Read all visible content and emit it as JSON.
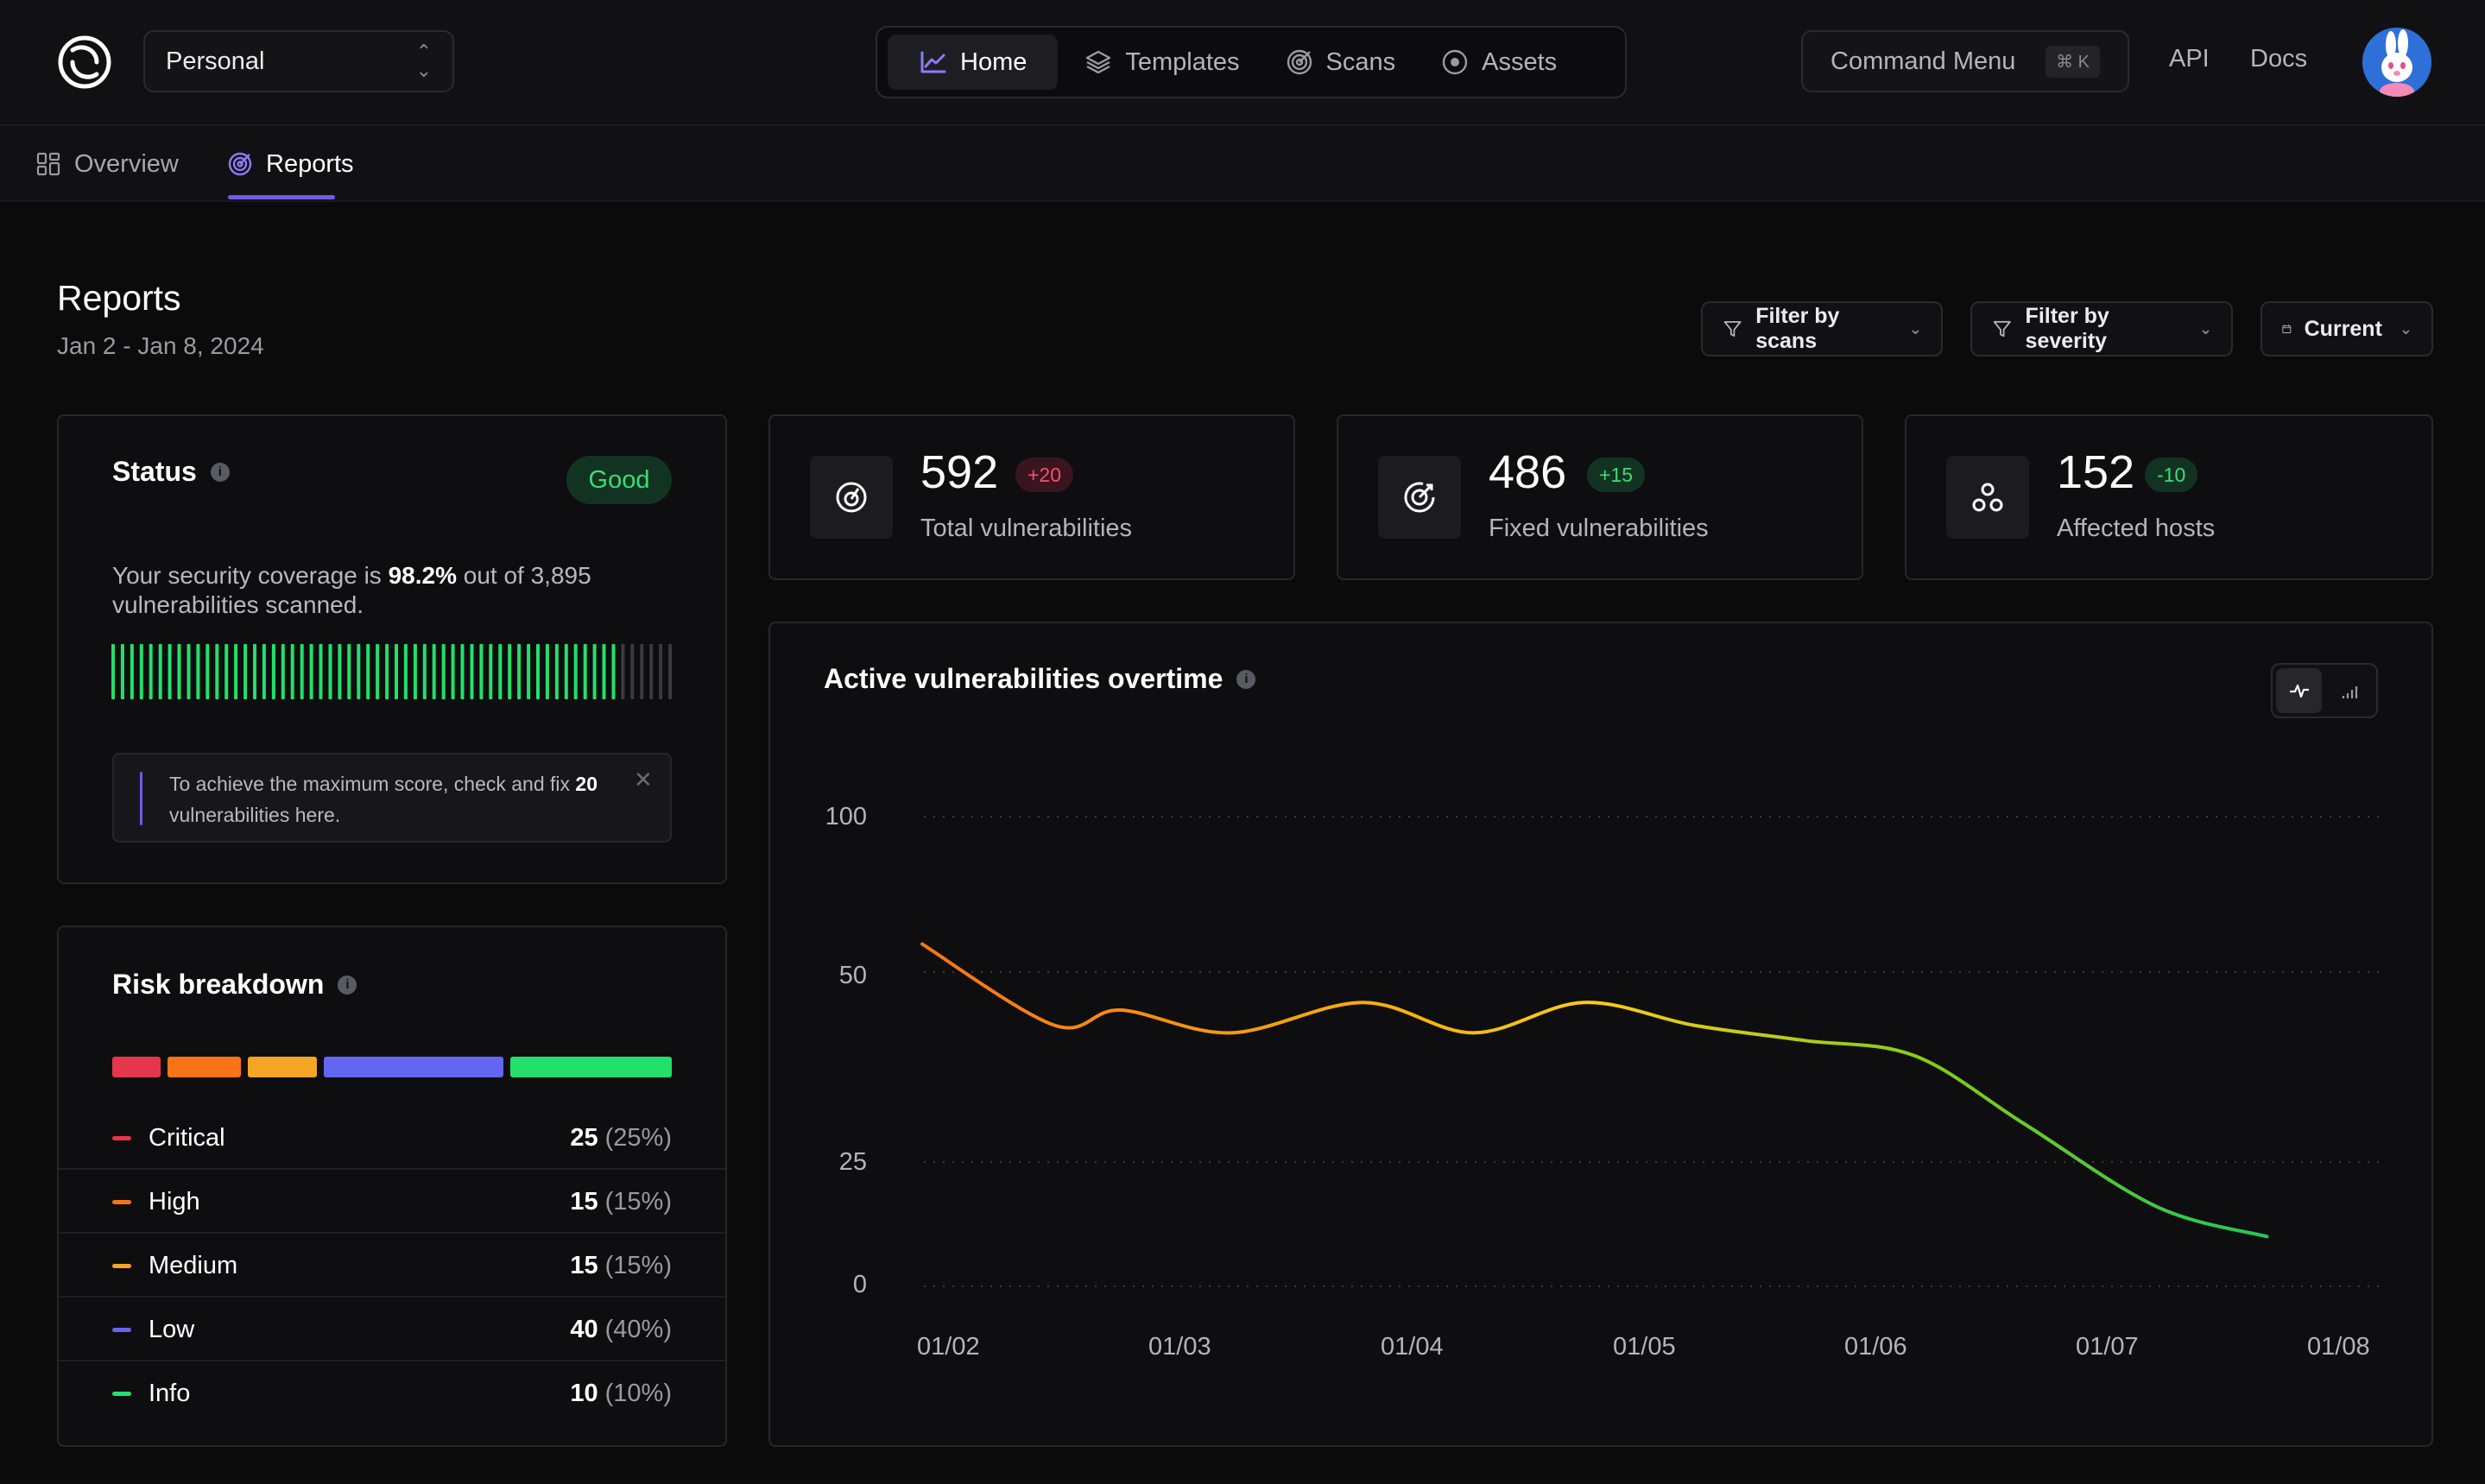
{
  "topbar": {
    "workspace": "Personal",
    "nav": [
      {
        "label": "Home",
        "icon": "chart-line-icon",
        "active": true
      },
      {
        "label": "Templates",
        "icon": "layers-icon",
        "active": false
      },
      {
        "label": "Scans",
        "icon": "target-icon",
        "active": false
      },
      {
        "label": "Assets",
        "icon": "radio-circle-icon",
        "active": false
      }
    ],
    "command_menu": "Command Menu",
    "command_shortcut": "⌘ K",
    "api": "API",
    "docs": "Docs"
  },
  "subnav": {
    "overview": "Overview",
    "reports": "Reports"
  },
  "header": {
    "title": "Reports",
    "date_range": "Jan 2 - Jan 8, 2024",
    "filter_scans": "Filter by scans",
    "filter_severity": "Filter by severity",
    "period": "Current"
  },
  "status": {
    "title": "Status",
    "badge": "Good",
    "coverage_prefix": "Your security coverage is ",
    "coverage_value": "98.2%",
    "coverage_mid": " out of 3,895",
    "coverage_suffix": "vulnerabilities scanned.",
    "coverage_fraction": 0.898,
    "hint_prefix": "To achieve the maximum score, check and fix ",
    "hint_count": "20",
    "hint_suffix": " vulnerabilities here."
  },
  "risk": {
    "title": "Risk breakdown",
    "rows": [
      {
        "label": "Critical",
        "count": "25",
        "pct": "(25%)",
        "color": "#e5364b"
      },
      {
        "label": "High",
        "count": "15",
        "pct": "(15%)",
        "color": "#f97316"
      },
      {
        "label": "Medium",
        "count": "15",
        "pct": "(15%)",
        "color": "#f5a524"
      },
      {
        "label": "Low",
        "count": "40",
        "pct": "(40%)",
        "color": "#6366f1"
      },
      {
        "label": "Info",
        "count": "10",
        "pct": "(10%)",
        "color": "#22e06b"
      }
    ]
  },
  "stats": [
    {
      "value": "592",
      "delta": "+20",
      "label": "Total vulnerabilities",
      "icon": "radar-icon",
      "delta_color": "#ff4d6a",
      "delta_bg": "#3a1520"
    },
    {
      "value": "486",
      "delta": "+15",
      "label": "Fixed vulnerabilities",
      "icon": "target-check-icon",
      "delta_color": "#3ddc74",
      "delta_bg": "#133322"
    },
    {
      "value": "152",
      "delta": "-10",
      "label": "Affected hosts",
      "icon": "hosts-icon",
      "delta_color": "#3ddc74",
      "delta_bg": "#133322"
    }
  ],
  "chart_data": {
    "type": "line",
    "title": "Active vulnerabilities overtime",
    "x": [
      "01/02",
      "01/03",
      "01/04",
      "01/05",
      "01/06",
      "01/07",
      "01/08"
    ],
    "y_ticks": [
      "100",
      "50",
      "25",
      "0"
    ],
    "series": [
      {
        "points": [
          [
            0.0,
            59
          ],
          [
            0.6,
            43
          ],
          [
            0.9,
            45
          ],
          [
            1.4,
            42
          ],
          [
            2.0,
            46
          ],
          [
            2.5,
            42
          ],
          [
            3.0,
            46
          ],
          [
            3.5,
            43
          ],
          [
            4.0,
            41
          ],
          [
            4.5,
            39
          ],
          [
            5.0,
            30
          ],
          [
            5.6,
            16
          ],
          [
            6.1,
            10
          ]
        ]
      }
    ],
    "grid": true,
    "gradient_colors": [
      "#f97316",
      "#f59e0b",
      "#facc15",
      "#84cc16",
      "#22c55e"
    ]
  }
}
